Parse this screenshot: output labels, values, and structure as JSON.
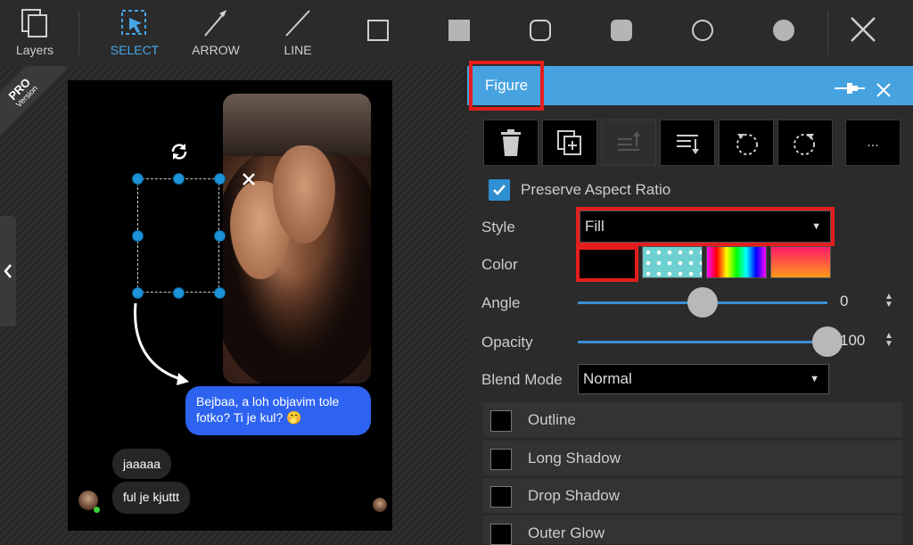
{
  "toolbar": {
    "items": [
      {
        "label": "Layers",
        "icon": "layers-icon"
      },
      {
        "label": "SELECT",
        "icon": "select-icon"
      },
      {
        "label": "ARROW",
        "icon": "arrow-icon"
      },
      {
        "label": "LINE",
        "icon": "line-icon"
      },
      {
        "label": "",
        "icon": "square-outline-icon"
      },
      {
        "label": "",
        "icon": "square-filled-icon"
      },
      {
        "label": "",
        "icon": "rounded-square-outline-icon"
      },
      {
        "label": "",
        "icon": "rounded-square-filled-icon"
      },
      {
        "label": "",
        "icon": "circle-outline-icon"
      },
      {
        "label": "",
        "icon": "circle-filled-icon"
      }
    ],
    "close_icon": "close-icon"
  },
  "workspace": {
    "pro_badge": {
      "line1": "PRO",
      "line2": "Version"
    },
    "messages": {
      "sent": "Bejbaa, a loh objavim tole fotko? Ti je kul? 🤭",
      "received": [
        "jaaaaa",
        "ful je kjuttt"
      ]
    }
  },
  "panel": {
    "title": "Figure",
    "more_label": "...",
    "preserve_aspect_ratio": {
      "label": "Preserve Aspect Ratio",
      "checked": true
    },
    "style": {
      "label": "Style",
      "value": "Fill"
    },
    "color": {
      "label": "Color",
      "value": "#000000"
    },
    "angle": {
      "label": "Angle",
      "value": "0",
      "fraction": 0.5
    },
    "opacity": {
      "label": "Opacity",
      "value": "100",
      "fraction": 1.0
    },
    "blend_mode": {
      "label": "Blend Mode",
      "value": "Normal"
    },
    "options": [
      {
        "label": "Outline",
        "checked": false
      },
      {
        "label": "Long Shadow",
        "checked": false
      },
      {
        "label": "Drop Shadow",
        "checked": false
      },
      {
        "label": "Outer Glow",
        "checked": false
      }
    ]
  },
  "colors": {
    "accent": "#46a3e0",
    "highlight": "#e41e1e",
    "message_blue": "#2d63f0"
  }
}
